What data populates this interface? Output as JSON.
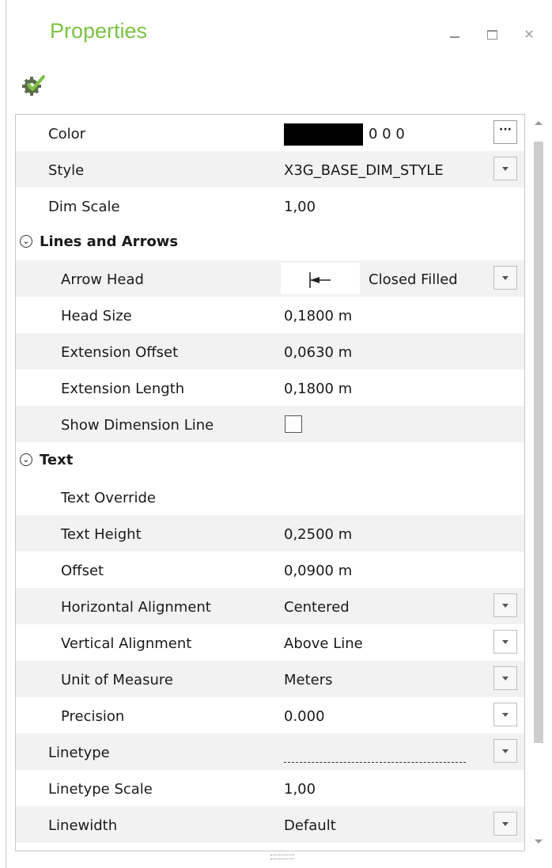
{
  "panel": {
    "title": "Properties",
    "title_color": "#7cc242",
    "window_buttons": {
      "close": "×"
    }
  },
  "icons": {
    "toolbar": "settings-check-icon",
    "category": "collapse-circle-icon"
  },
  "properties": {
    "color": {
      "label": "Color",
      "value": "0 0 0",
      "swatch": "#000000"
    },
    "style": {
      "label": "Style",
      "value": "X3G_BASE_DIM_STYLE"
    },
    "dim_scale": {
      "label": "Dim Scale",
      "value": "1,00"
    },
    "lines_and_arrows": {
      "label": "Lines and Arrows",
      "arrow_head": {
        "label": "Arrow Head",
        "value": "Closed Filled"
      },
      "head_size": {
        "label": "Head Size",
        "value": "0,1800 m"
      },
      "extension_offset": {
        "label": "Extension Offset",
        "value": "0,0630 m"
      },
      "extension_length": {
        "label": "Extension Length",
        "value": "0,1800 m"
      },
      "show_dimension_line": {
        "label": "Show Dimension Line",
        "checked": false
      }
    },
    "text": {
      "label": "Text",
      "text_override": {
        "label": "Text Override",
        "value": ""
      },
      "text_height": {
        "label": "Text Height",
        "value": "0,2500 m"
      },
      "offset": {
        "label": "Offset",
        "value": "0,0900 m"
      },
      "horizontal_alignment": {
        "label": "Horizontal Alignment",
        "value": "Centered"
      },
      "vertical_alignment": {
        "label": "Vertical Alignment",
        "value": "Above Line"
      },
      "unit_of_measure": {
        "label": "Unit of Measure",
        "value": "Meters"
      },
      "precision": {
        "label": "Precision",
        "value": "0.000"
      }
    },
    "linetype": {
      "label": "Linetype"
    },
    "linetype_scale": {
      "label": "Linetype Scale",
      "value": "1,00"
    },
    "linewidth": {
      "label": "Linewidth",
      "value": "Default"
    }
  }
}
